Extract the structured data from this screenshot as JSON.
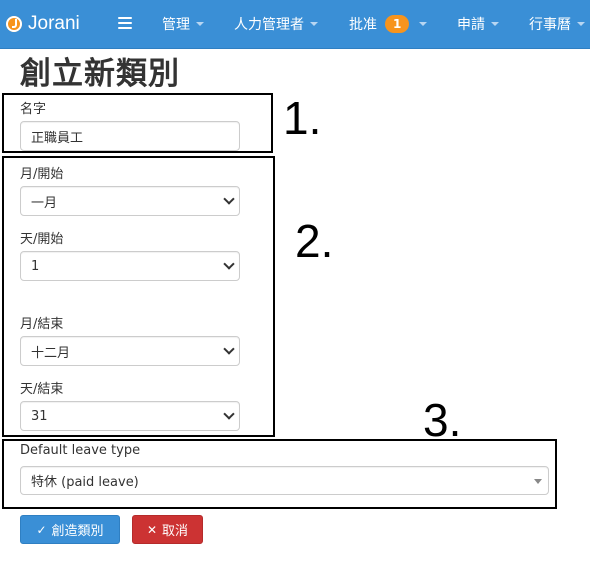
{
  "navbar": {
    "brand": "Jorani",
    "menu": [
      {
        "label": "管理"
      },
      {
        "label": "人力管理者"
      },
      {
        "label": "批准",
        "badge": "1"
      },
      {
        "label": "申請"
      },
      {
        "label": "行事曆"
      }
    ]
  },
  "page": {
    "title": "創立新類別"
  },
  "form": {
    "name": {
      "label": "名字",
      "value": "正職員工"
    },
    "month_start": {
      "label": "月/開始",
      "value": "一月"
    },
    "day_start": {
      "label": "天/開始",
      "value": "1"
    },
    "month_end": {
      "label": "月/結束",
      "value": "十二月"
    },
    "day_end": {
      "label": "天/結束",
      "value": "31"
    },
    "default_leave_type": {
      "label": "Default leave type",
      "value": "特休 (paid leave)"
    }
  },
  "annotations": [
    "1.",
    "2.",
    "3."
  ],
  "buttons": {
    "create": {
      "label": "創造類別",
      "icon": "check-icon"
    },
    "cancel": {
      "label": "取消",
      "icon": "close-icon"
    }
  },
  "colors": {
    "navbar": "#3a8fd6",
    "badge": "#f7941d",
    "primary": "#3a8fd6",
    "danger": "#cc3333"
  }
}
